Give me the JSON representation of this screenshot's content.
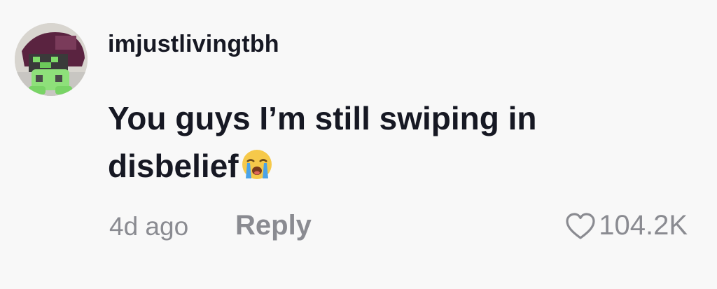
{
  "comment": {
    "username": "imjustlivingtbh",
    "text": "You guys I’m still swiping in disbelief",
    "emoji": "loudly-crying-face",
    "time_ago": "4d ago",
    "reply_label": "Reply",
    "like_count": "104.2K"
  },
  "colors": {
    "background": "#f8f8f8",
    "primary_text": "#161823",
    "secondary_text": "#8a8b91"
  },
  "icons": {
    "like": "heart-outline-icon",
    "avatar": "user-avatar-image"
  }
}
